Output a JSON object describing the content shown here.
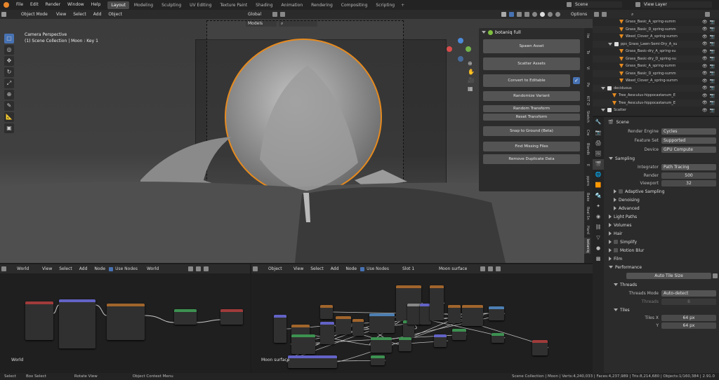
{
  "topbar": {
    "menus": [
      "File",
      "Edit",
      "Render",
      "Window",
      "Help"
    ],
    "workspaces": [
      "Layout",
      "Modeling",
      "Sculpting",
      "UV Editing",
      "Texture Paint",
      "Shading",
      "Animation",
      "Rendering",
      "Compositing",
      "Scripting"
    ],
    "active_workspace": "Layout",
    "scene": "Scene",
    "view_layer": "View Layer"
  },
  "viewport": {
    "mode": "Object Mode",
    "menus": [
      "View",
      "Select",
      "Add",
      "Object"
    ],
    "transform": "Global",
    "overlay_label": "Models",
    "options": "Options",
    "camera_label": "Camera Perspective",
    "collection_label": "(1) Scene Collection | Moon : Key 1"
  },
  "botaniq": {
    "title": "botaniq full",
    "buttons": [
      "Spawn Asset",
      "Scatter Assets",
      "Convert to Editable",
      "Randomize Variant",
      "Random Transform",
      "Reset Transform",
      "Snap to Ground (Beta)",
      "Find Missing Files",
      "Remove Duplicate Data"
    ],
    "side_tabs": [
      "Ite",
      "To",
      "Vi",
      "Po",
      "KIT O",
      "Sketch",
      "Cre",
      "Blendk",
      "E",
      "ppers",
      "Bake",
      "Real Sn",
      "Hard",
      "botaniq"
    ]
  },
  "outliner": {
    "items": [
      {
        "name": "Grass_Basic_A_spring-summ",
        "indent": 2
      },
      {
        "name": "Grass_Basic_D_spring-summ",
        "indent": 2
      },
      {
        "name": "Weed_Clover_A_spring-summ",
        "indent": 2
      },
      {
        "name": "pps_Grass_Lawn-Semi-Dry_A_su",
        "indent": 1
      },
      {
        "name": "Grass_Basic-dry_A_spring-su",
        "indent": 2
      },
      {
        "name": "Grass_Basic-dry_D_spring-su",
        "indent": 2
      },
      {
        "name": "Grass_Basic_A_spring-summ",
        "indent": 2
      },
      {
        "name": "Grass_Basic_D_spring-summ",
        "indent": 2
      },
      {
        "name": "Weed_Clover_A_spring-summ",
        "indent": 2
      },
      {
        "name": "deciduous",
        "indent": 0
      },
      {
        "name": "Tree_Aesculus-hippocastanum_E",
        "indent": 1
      },
      {
        "name": "Tree_Aesculus-hippocastanum_E",
        "indent": 1
      },
      {
        "name": "Scatter",
        "indent": 0
      }
    ]
  },
  "properties": {
    "context": "Scene",
    "render_engine_label": "Render Engine",
    "render_engine": "Cycles",
    "feature_set_label": "Feature Set",
    "feature_set": "Supported",
    "device_label": "Device",
    "device": "GPU Compute",
    "sampling": "Sampling",
    "integrator_label": "Integrator",
    "integrator": "Path Tracing",
    "render_label": "Render",
    "render_samples": "500",
    "viewport_label": "Viewport",
    "viewport_samples": "32",
    "adaptive_sampling": "Adaptive Sampling",
    "denoising": "Denoising",
    "advanced": "Advanced",
    "light_paths": "Light Paths",
    "volumes": "Volumes",
    "hair": "Hair",
    "simplify": "Simplify",
    "motion_blur": "Motion Blur",
    "film": "Film",
    "performance": "Performance",
    "auto_tile_size": "Auto Tile Size",
    "threads": "Threads",
    "threads_mode_label": "Threads Mode",
    "threads_mode": "Auto-detect",
    "threads_label": "Threads",
    "threads_value": "6",
    "tiles": "Tiles",
    "tiles_x_label": "Tiles X",
    "tiles_x": "64 px",
    "tiles_y_label": "Y",
    "tiles_y": "64 px"
  },
  "world_editor": {
    "type": "World",
    "menus": [
      "View",
      "Select",
      "Add",
      "Node"
    ],
    "use_nodes": "Use Nodes",
    "datablock": "World",
    "footer": "World"
  },
  "shader_editor": {
    "type": "Object",
    "menus": [
      "View",
      "Select",
      "Add",
      "Node"
    ],
    "use_nodes": "Use Nodes",
    "slot": "Slot 1",
    "material": "Moon surface",
    "footer": "Moon surface"
  },
  "statusbar": {
    "select": "Select",
    "box_select": "Box Select",
    "rotate_view": "Rotate View",
    "context_menu": "Object Context Menu",
    "stats": "Scene Collection | Moon | Verts:4,240,033 | Faces:4,237,989 | Tris:8,214,680 | Objects:1/160,384 | 2.91.0"
  },
  "colors": {
    "accent": "#4772b3",
    "orange": "#e58a1f",
    "node_shader": "#3d9151",
    "node_texture": "#a1652c",
    "node_vector": "#6363c7",
    "node_output": "#a13b3b"
  }
}
